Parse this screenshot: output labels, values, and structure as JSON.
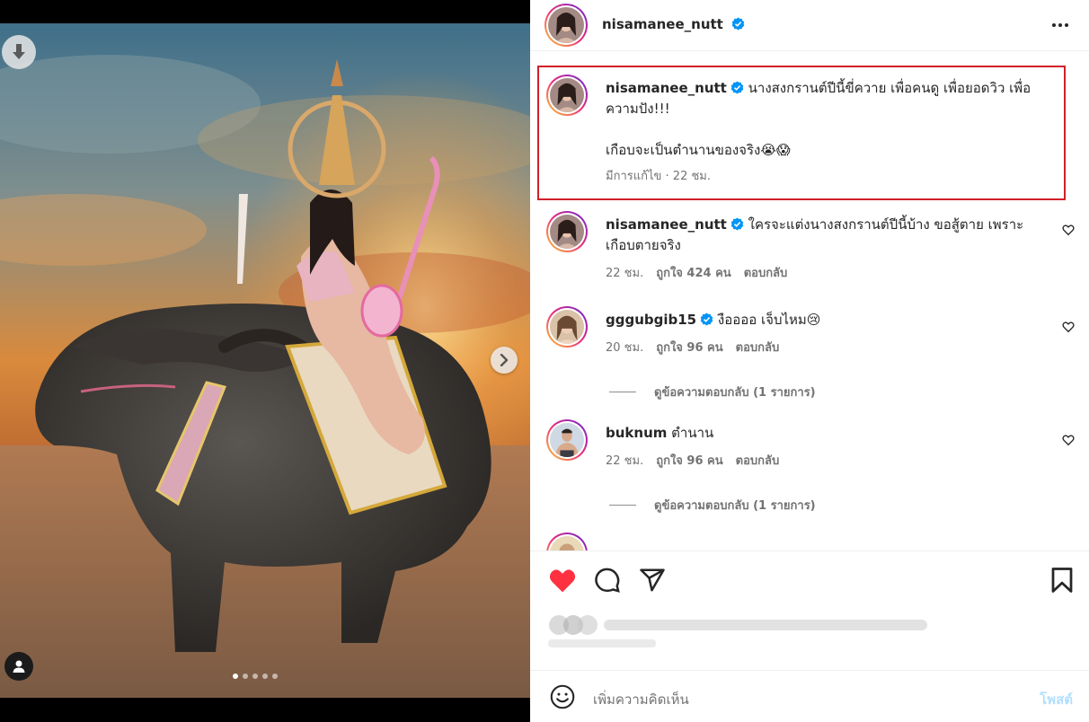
{
  "post": {
    "username": "nisamanee_nutt",
    "verified": true,
    "more_icon": "more-horizontal-icon"
  },
  "photo": {
    "carousel_dots": 5,
    "active_dot": 1,
    "icons": [
      "download-icon",
      "chevron-right-icon",
      "user-tag-icon"
    ]
  },
  "caption": {
    "username": "nisamanee_nutt",
    "line1": "นางสงกรานต์ปีนี้ขี่ควาย เพื่อคนดู เพื่อยอดวิว เพื่อ",
    "line2": "ความปัง!!!",
    "line3": "เกือบจะเป็นตำนานของจริง😭😱",
    "meta": "มีการแก้ไข · 22 ชม."
  },
  "comments": [
    {
      "username": "nisamanee_nutt",
      "verified": true,
      "text_line1": "ใครจะแต่งนางสงกรานต์ปีนี้บ้าง ขอสู้ตาย เพราะ",
      "text_line2": "เกือบตายจริง",
      "time": "22 ชม.",
      "likes": "ถูกใจ 424 คน",
      "reply": "ตอบกลับ"
    },
    {
      "username": "gggubgib15",
      "verified": true,
      "text_line1": "งืออออ เจ็บไหม😢",
      "time": "20 ชม.",
      "likes": "ถูกใจ 96 คน",
      "reply": "ตอบกลับ",
      "view_replies": "ดูข้อความตอบกลับ (1 รายการ)"
    },
    {
      "username": "buknum",
      "verified": false,
      "text_line1": "ตำนาน",
      "time": "22 ชม.",
      "likes": "ถูกใจ 96 คน",
      "reply": "ตอบกลับ",
      "view_replies": "ดูข้อความตอบกลับ (1 รายการ)"
    }
  ],
  "actions": {
    "icons": [
      "heart-filled-icon",
      "comment-icon",
      "share-icon",
      "bookmark-icon"
    ],
    "like_color": "#ff3040"
  },
  "add_comment": {
    "placeholder": "เพิ่มความคิดเห็น",
    "post_label": "โพสต์",
    "emoji_icon": "emoji-icon"
  },
  "colors": {
    "verified": "#0095f6",
    "highlight_border": "#d21f2a",
    "post_button": "#b2dffc"
  }
}
